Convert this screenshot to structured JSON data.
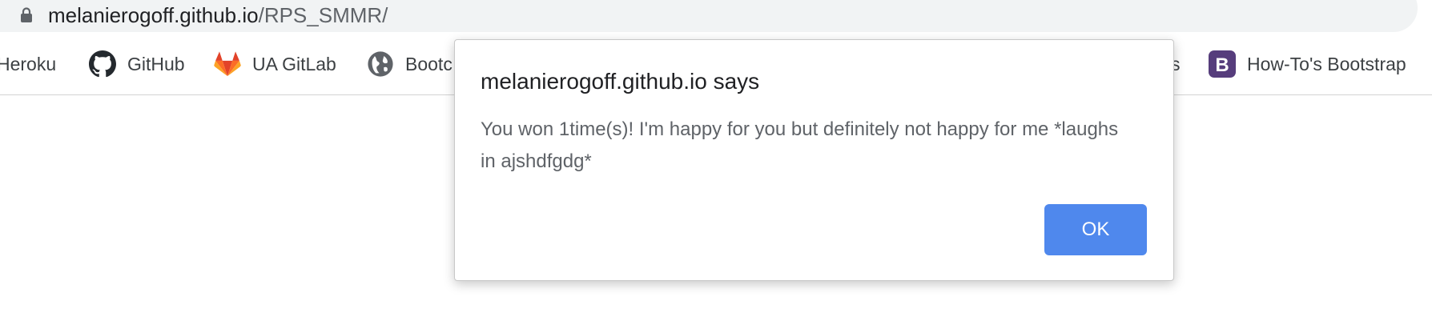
{
  "address_bar": {
    "domain": "melanierogoff.github.io",
    "path": "/RPS_SMMR/",
    "icon": "lock-icon"
  },
  "bookmarks": [
    {
      "label": "Heroku",
      "icon": ""
    },
    {
      "label": "GitHub",
      "icon": "github-icon"
    },
    {
      "label": "UA GitLab",
      "icon": "gitlab-icon"
    },
    {
      "label": "Bootc",
      "icon": "globe-icon"
    },
    {
      "label": "s",
      "icon": ""
    },
    {
      "label": "How-To's Bootstrap",
      "icon": "bootstrap-icon"
    }
  ],
  "dialog": {
    "title": "melanierogoff.github.io says",
    "message": "You won 1time(s)! I'm happy for you but definitely not happy for me *laughs in ajshdfgdg*",
    "ok_label": "OK"
  },
  "colors": {
    "ok_button": "#4f88ed",
    "bootstrap_purple": "#563d7c",
    "gitlab_orange": "#e24329"
  }
}
